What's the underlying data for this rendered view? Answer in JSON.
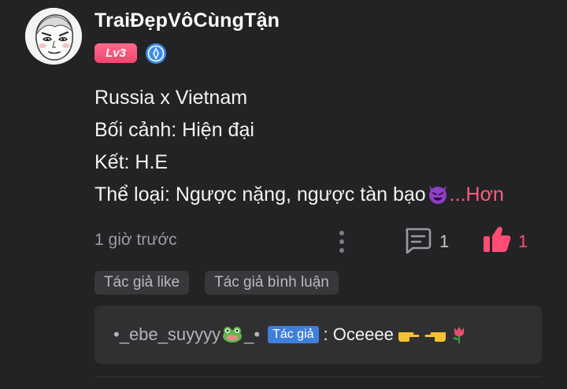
{
  "post": {
    "username": "TraiĐẹpVôCùngTận",
    "level": "Lv3",
    "content_lines": [
      "Russia x Vietnam",
      "Bối cảnh: Hiện đại",
      "Kết: H.E",
      "Thể loại: Ngược nặng, ngược tàn bạo"
    ],
    "more_label": "...Hơn",
    "time": "1 giờ trước",
    "comment_count": "1",
    "like_count": "1",
    "tags": [
      "Tác giả like",
      "Tác giả bình luận"
    ]
  },
  "reply": {
    "username": "•_ebe_suyyyy",
    "username_suffix": "_•",
    "author_badge": "Tác giả",
    "separator": ":",
    "text": "Oceeee"
  },
  "colors": {
    "background": "#232325",
    "accent_pink": "#ff4d73",
    "author_badge_blue": "#3f7fdc"
  }
}
